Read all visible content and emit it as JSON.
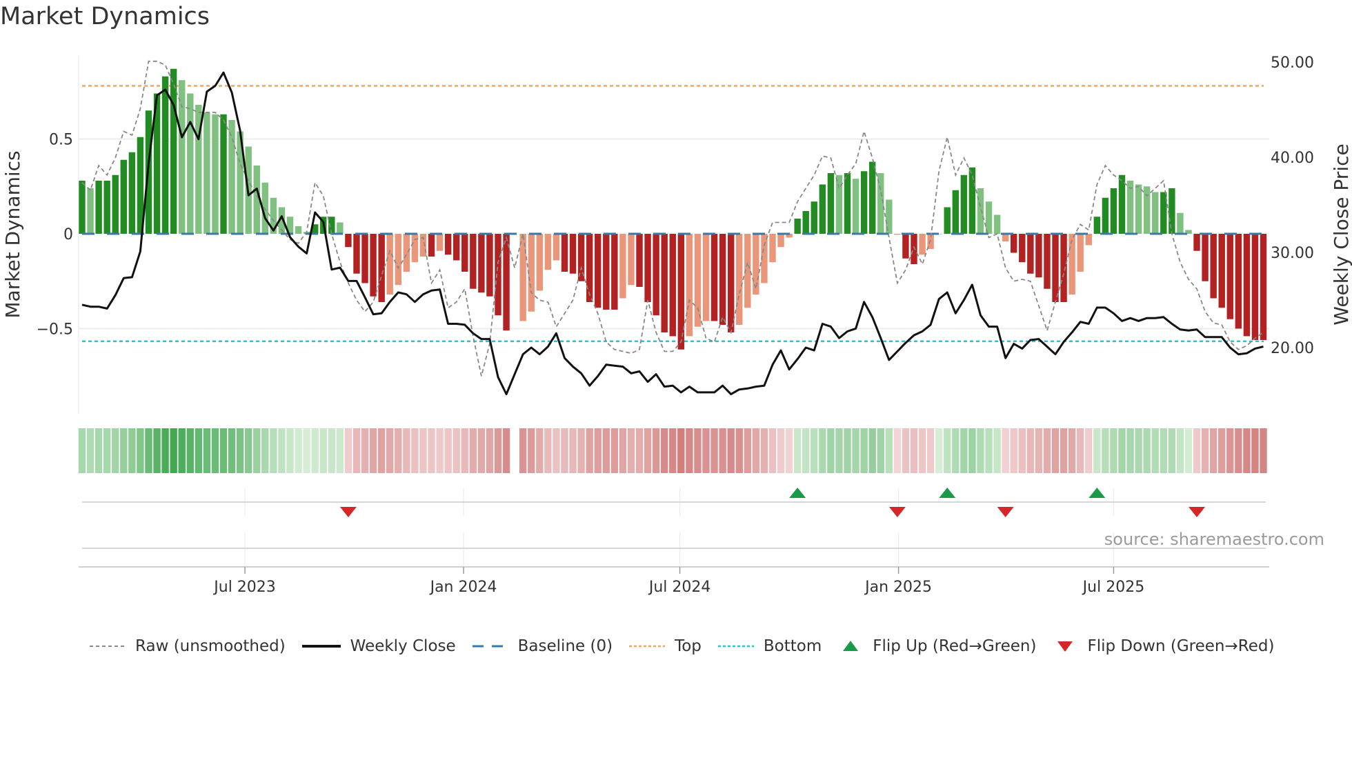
{
  "title": "Market Dynamics",
  "source": "source: sharemaestro.com",
  "colors": {
    "strong_up": "#228b22",
    "weak_up": "#80c080",
    "strong_down": "#b22222",
    "weak_down": "#e9967a",
    "raw": "#888888",
    "close": "#111111",
    "baseline": "#3a78a8",
    "top": "#f0a560",
    "bottom": "#22c3d3",
    "flip_up": "#1a9a48",
    "flip_down": "#d62728"
  },
  "legend": [
    {
      "key": "raw",
      "label": "Raw (unsmoothed)"
    },
    {
      "key": "close",
      "label": "Weekly Close"
    },
    {
      "key": "baseline",
      "label": "Baseline (0)"
    },
    {
      "key": "top",
      "label": "Top"
    },
    {
      "key": "bottom",
      "label": "Bottom"
    },
    {
      "key": "flip_up",
      "label": "Flip Up (Red→Green)"
    },
    {
      "key": "flip_down",
      "label": "Flip Down (Green→Red)"
    }
  ],
  "chart_data": {
    "type": "bar",
    "title": "Market Dynamics",
    "ylabel": "Market Dynamics",
    "ylabel_right": "Weekly Close Price",
    "x_start": "2023-02-14",
    "x_frequency_days": 7,
    "ylim": [
      -0.95,
      0.97
    ],
    "ylim_right": [
      13.3,
      51.5
    ],
    "yticks": [
      {
        "value": 0.5,
        "label": "0.5"
      },
      {
        "value": 0,
        "label": "0"
      },
      {
        "value": -0.5,
        "label": "−0.5"
      }
    ],
    "yticks_right": [
      {
        "value": 50,
        "label": "50.00"
      },
      {
        "value": 40,
        "label": "40.00"
      },
      {
        "value": 30,
        "label": "30.00"
      },
      {
        "value": 20,
        "label": "20.00"
      }
    ],
    "xticks": [
      {
        "date": "2023-07-01",
        "label": "Jul 2023"
      },
      {
        "date": "2024-01-01",
        "label": "Jan 2024"
      },
      {
        "date": "2024-07-01",
        "label": "Jul 2024"
      },
      {
        "date": "2025-01-01",
        "label": "Jan 2025"
      },
      {
        "date": "2025-07-01",
        "label": "Jul 2025"
      }
    ],
    "top_level": 0.78,
    "bottom_level": -0.567,
    "baseline": 0,
    "dynamics": [
      0.28,
      0.24,
      0.28,
      0.28,
      0.31,
      0.39,
      0.43,
      0.51,
      0.65,
      0.74,
      0.83,
      0.87,
      0.81,
      0.74,
      0.68,
      0.64,
      0.63,
      0.63,
      0.6,
      0.54,
      0.46,
      0.36,
      0.27,
      0.19,
      0.14,
      0.09,
      0.04,
      0.01,
      0.05,
      0.09,
      0.09,
      0.06,
      -0.07,
      -0.21,
      -0.26,
      -0.33,
      -0.36,
      -0.32,
      -0.27,
      -0.2,
      -0.15,
      -0.12,
      -0.12,
      -0.09,
      -0.11,
      -0.14,
      -0.2,
      -0.29,
      -0.31,
      -0.33,
      -0.43,
      -0.51,
      null,
      -0.46,
      -0.41,
      -0.3,
      -0.19,
      -0.14,
      -0.2,
      -0.21,
      -0.25,
      -0.36,
      -0.39,
      -0.4,
      -0.4,
      -0.34,
      -0.27,
      -0.28,
      -0.36,
      -0.43,
      -0.52,
      -0.54,
      -0.61,
      -0.54,
      -0.49,
      -0.46,
      -0.46,
      -0.48,
      -0.52,
      -0.48,
      -0.39,
      -0.32,
      -0.26,
      -0.15,
      -0.07,
      -0.02,
      0.08,
      0.12,
      0.17,
      0.26,
      0.32,
      0.31,
      0.32,
      0.29,
      0.33,
      0.38,
      0.32,
      0.18,
      -0.005,
      -0.13,
      -0.16,
      -0.11,
      -0.08,
      0,
      0.14,
      0.23,
      0.31,
      0.35,
      0.24,
      0.17,
      0.1,
      -0.04,
      -0.1,
      -0.15,
      -0.21,
      -0.23,
      -0.29,
      -0.36,
      -0.36,
      -0.32,
      -0.2,
      -0.06,
      0.09,
      0.19,
      0.24,
      0.31,
      0.28,
      0.26,
      0.25,
      0.22,
      0.22,
      0.24,
      0.11,
      0.02,
      -0.09,
      -0.25,
      -0.34,
      -0.39,
      -0.45,
      -0.5,
      -0.54,
      -0.56,
      -0.56
    ],
    "raw": [
      0.27,
      0.23,
      0.36,
      0.31,
      0.4,
      0.54,
      0.52,
      0.66,
      0.91,
      0.91,
      0.89,
      0.79,
      0.67,
      0.66,
      0.64,
      0.64,
      0.64,
      0.6,
      0.51,
      0.37,
      0.28,
      0.2,
      0.13,
      0.07,
      0.02,
      -0.03,
      -0.05,
      0.01,
      0.27,
      0.2,
      0.0,
      -0.15,
      -0.26,
      -0.35,
      -0.41,
      -0.36,
      -0.22,
      -0.09,
      -0.18,
      -0.11,
      -0.03,
      -0.02,
      -0.26,
      -0.19,
      -0.39,
      -0.36,
      -0.29,
      -0.54,
      -0.75,
      -0.58,
      -0.15,
      -0.02,
      -0.18,
      0.0,
      -0.31,
      -0.35,
      -0.36,
      -0.49,
      -0.42,
      -0.35,
      -0.18,
      -0.32,
      -0.42,
      -0.57,
      -0.61,
      -0.62,
      -0.63,
      -0.61,
      -0.35,
      -0.52,
      -0.62,
      -0.62,
      -0.57,
      -0.35,
      -0.39,
      -0.55,
      -0.57,
      -0.44,
      -0.52,
      -0.32,
      -0.15,
      -0.29,
      -0.06,
      0.06,
      0.06,
      0.06,
      0.17,
      0.24,
      0.31,
      0.41,
      0.4,
      0.24,
      0.31,
      0.37,
      0.54,
      0.4,
      0.23,
      -0.02,
      -0.26,
      -0.19,
      -0.07,
      -0.16,
      -0.03,
      0.33,
      0.51,
      0.31,
      0.4,
      0.31,
      0.14,
      -0.02,
      0.0,
      -0.18,
      -0.25,
      -0.24,
      -0.25,
      -0.38,
      -0.51,
      -0.36,
      -0.21,
      -0.03,
      0.05,
      0.02,
      0.26,
      0.36,
      0.31,
      0.28,
      0.24,
      0.25,
      0.2,
      0.24,
      0.28,
      0.0,
      -0.15,
      -0.24,
      -0.29,
      -0.41,
      -0.47,
      -0.48,
      -0.57,
      -0.61,
      -0.59,
      -0.55,
      -0.52
    ],
    "weekly_close": [
      24.5,
      24.3,
      24.3,
      24.1,
      25.5,
      27.3,
      27.4,
      30.1,
      39.4,
      46.5,
      47.1,
      45.5,
      42.1,
      43.7,
      41.9,
      46.9,
      47.5,
      48.9,
      46.8,
      42.8,
      36.0,
      36.7,
      33.6,
      32.3,
      33.8,
      31.6,
      30.6,
      29.9,
      34.2,
      33.2,
      28.2,
      28.4,
      27.0,
      27.0,
      25.3,
      23.5,
      23.6,
      24.8,
      25.8,
      25.6,
      24.8,
      25.6,
      26.0,
      26.1,
      22.5,
      22.5,
      22.4,
      21.5,
      20.9,
      20.9,
      16.9,
      15.1,
      17.2,
      19.3,
      20.0,
      19.3,
      20.1,
      21.5,
      18.9,
      18.0,
      17.3,
      16.0,
      17.0,
      18.2,
      18.1,
      18.0,
      17.3,
      17.5,
      16.4,
      17.2,
      15.9,
      16.0,
      15.3,
      15.9,
      15.3,
      15.3,
      15.3,
      16.0,
      15.1,
      15.6,
      15.7,
      15.9,
      16.0,
      18.2,
      19.7,
      17.7,
      18.8,
      20.0,
      19.7,
      22.5,
      22.2,
      21.0,
      21.7,
      22.0,
      24.8,
      23.2,
      21.0,
      18.7,
      19.6,
      20.5,
      21.3,
      21.7,
      22.4,
      25.1,
      25.8,
      23.6,
      25.0,
      26.6,
      23.4,
      22.2,
      22.2,
      18.9,
      20.4,
      19.9,
      20.8,
      20.9,
      20.1,
      19.3,
      20.6,
      21.6,
      22.7,
      22.5,
      24.2,
      24.2,
      23.6,
      22.8,
      23.1,
      22.8,
      23.1,
      23.1,
      23.2,
      22.5,
      21.9,
      21.8,
      21.9,
      21.1,
      21.1,
      21.1,
      20.0,
      19.3,
      19.4,
      19.9,
      20.1
    ],
    "flip_up_weeks": [
      86,
      104,
      122
    ],
    "flip_down_weeks": [
      32,
      98,
      111,
      134
    ]
  }
}
